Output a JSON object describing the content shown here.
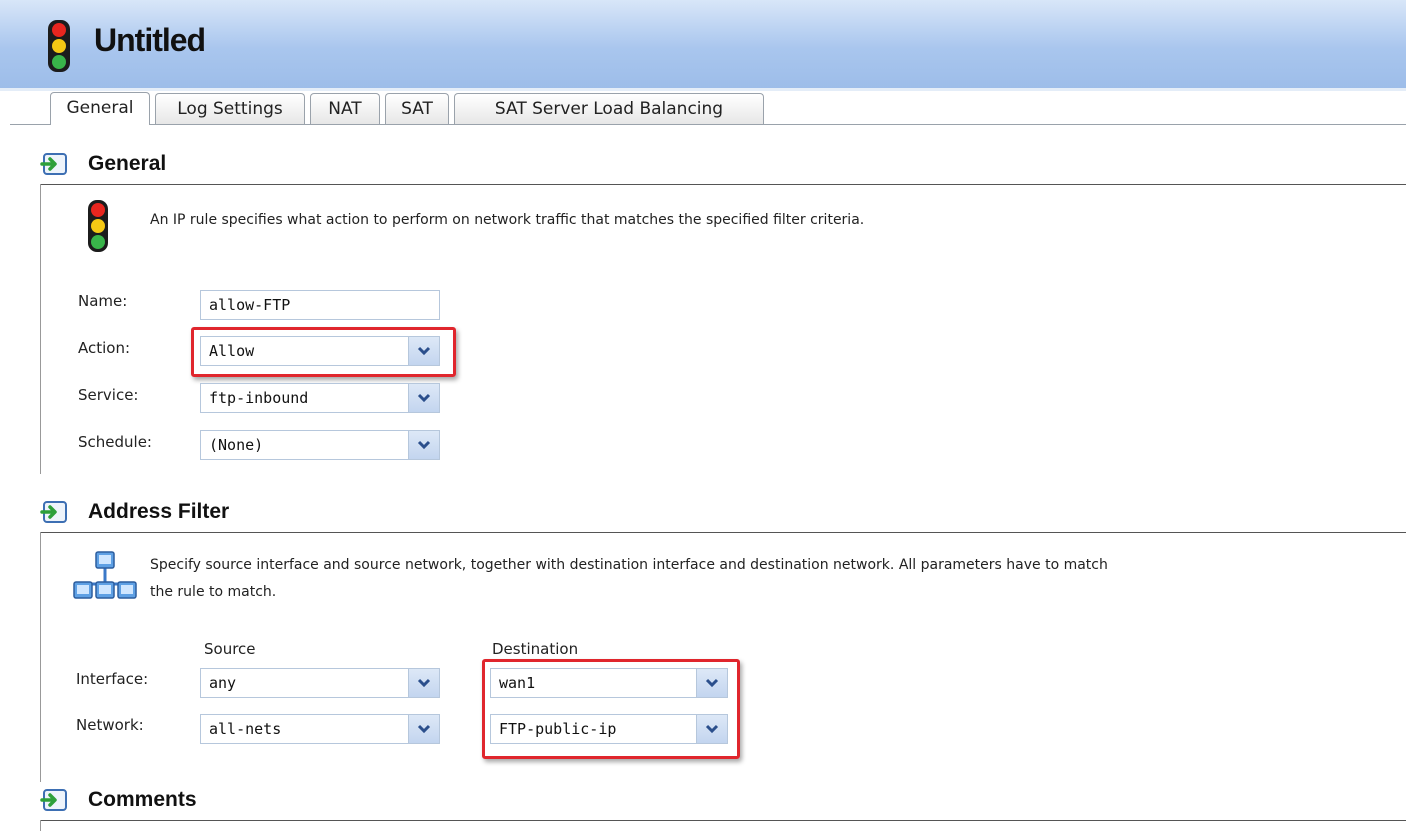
{
  "window": {
    "title": "Untitled"
  },
  "tabs": [
    {
      "label": "General",
      "active": true
    },
    {
      "label": "Log Settings",
      "active": false
    },
    {
      "label": "NAT",
      "active": false
    },
    {
      "label": "SAT",
      "active": false
    },
    {
      "label": "SAT Server Load Balancing",
      "active": false
    }
  ],
  "general": {
    "heading": "General",
    "description": "An IP rule specifies what action to perform on network traffic that matches the specified filter criteria.",
    "name_label": "Name:",
    "name_value": "allow-FTP",
    "action_label": "Action:",
    "action_value": "Allow",
    "service_label": "Service:",
    "service_value": "ftp-inbound",
    "schedule_label": "Schedule:",
    "schedule_value": "(None)"
  },
  "address_filter": {
    "heading": "Address Filter",
    "description_line1": "Specify source interface and source network, together with destination interface and destination network. All parameters have to match",
    "description_line2": "the rule to match.",
    "source_header": "Source",
    "destination_header": "Destination",
    "interface_label": "Interface:",
    "network_label": "Network:",
    "source_interface": "any",
    "source_network": "all-nets",
    "destination_interface": "wan1",
    "destination_network": "FTP-public-ip"
  },
  "comments": {
    "heading": "Comments"
  },
  "colors": {
    "highlight": "#e0262d",
    "titlebar": "#a9c6ee"
  },
  "icons": [
    "traffic-light-icon",
    "section-arrow-icon",
    "network-icon",
    "chevron-down-icon"
  ]
}
